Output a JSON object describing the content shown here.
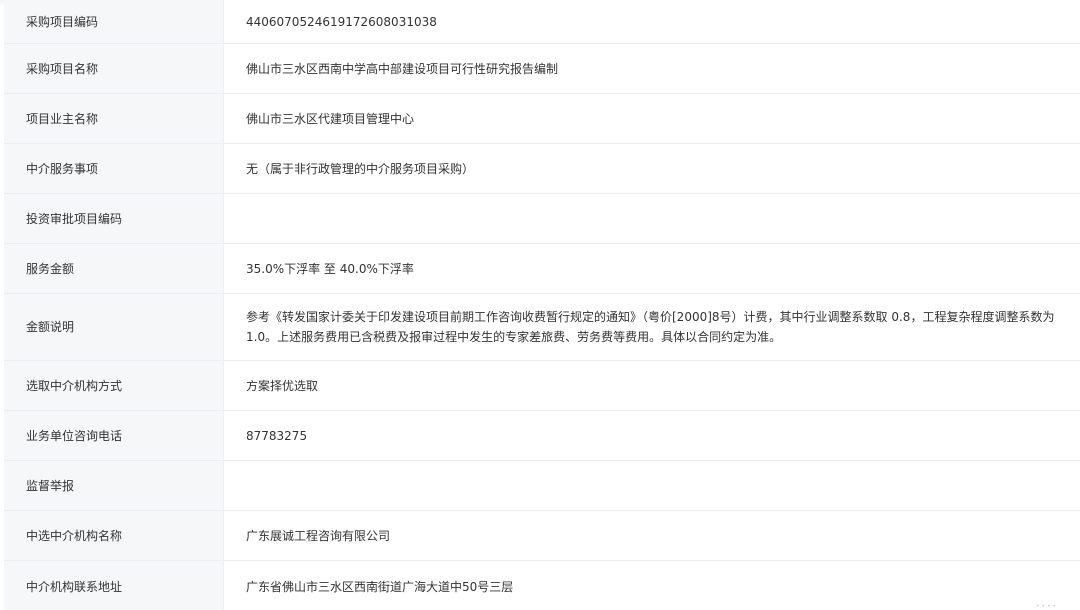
{
  "details": {
    "rows": [
      {
        "label": "采购项目编码",
        "value": "440607052461917260803103​8"
      },
      {
        "label": "采购项目名称",
        "value": "佛山市三水区西南中学高中部建设项目可行性研究报告编制"
      },
      {
        "label": "项目业主名称",
        "value": "佛山市三水区代建项目管理中心"
      },
      {
        "label": "中介服务事项",
        "value": "无（属于非行政管理的中介服务项目采购）"
      },
      {
        "label": "投资审批项目编码",
        "value": ""
      },
      {
        "label": "服务金额",
        "value": "35.0%下浮率 至 40.0%下浮率"
      },
      {
        "label": "金额说明",
        "value": "参考《转发国家计委关于印发建设项目前期工作咨询收费暂行规定的通知》（粤价[2000]8号）计费，其中行业调整系数取 0.8，工程复杂程度调整系数为 1.0。上述服务费用已含税费及报审过程中发生的专家差旅费、劳务费等费用。具体以合同约定为准。"
      },
      {
        "label": "选取中介机构方式",
        "value": "方案择优选取"
      },
      {
        "label": "业务单位咨询电话",
        "value": "87783275"
      },
      {
        "label": "监督举报",
        "value": ""
      },
      {
        "label": "中选中介机构名称",
        "value": "广东展诚工程咨询有限公司"
      },
      {
        "label": "中介机构联系地址",
        "value": "广东省佛山市三水区西南街道广海大道中50号三层"
      }
    ]
  }
}
